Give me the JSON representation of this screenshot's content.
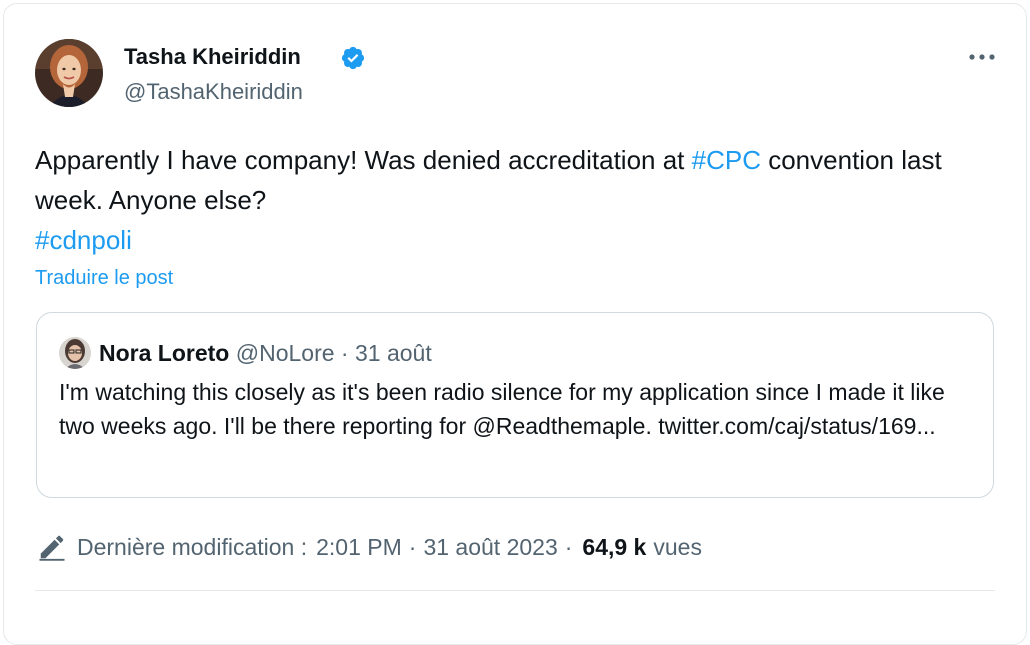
{
  "author": {
    "name": "Tasha Kheiriddin",
    "handle": "@TashaKheiriddin",
    "verified": true
  },
  "tweet": {
    "text_part1": "Apparently I have company! Was denied accreditation at ",
    "hashtag1": "#CPC",
    "text_part2": " convention last week. Anyone else?",
    "hashtag2": "#cdnpoli"
  },
  "translate_label": "Traduire le post",
  "quoted_tweet": {
    "name": "Nora Loreto",
    "handle": "@NoLore",
    "separator": "·",
    "date": "31 août",
    "text": "I'm watching this closely as it's been radio silence for my application since I made it like two weeks ago. I'll be there reporting for @Readthemaple. twitter.com/caj/status/169..."
  },
  "footer": {
    "edited_label": "Dernière modification :",
    "time": "2:01 PM",
    "separator": "·",
    "date": "31 août 2023",
    "separator2": "·",
    "views_count": "64,9 k",
    "views_label": "vues"
  },
  "colors": {
    "link": "#1d9bf0",
    "verified": "#1d9bf0",
    "secondary_text": "#536471"
  },
  "icons": [
    "verified-badge-icon",
    "more-options-icon",
    "edit-pencil-icon"
  ]
}
